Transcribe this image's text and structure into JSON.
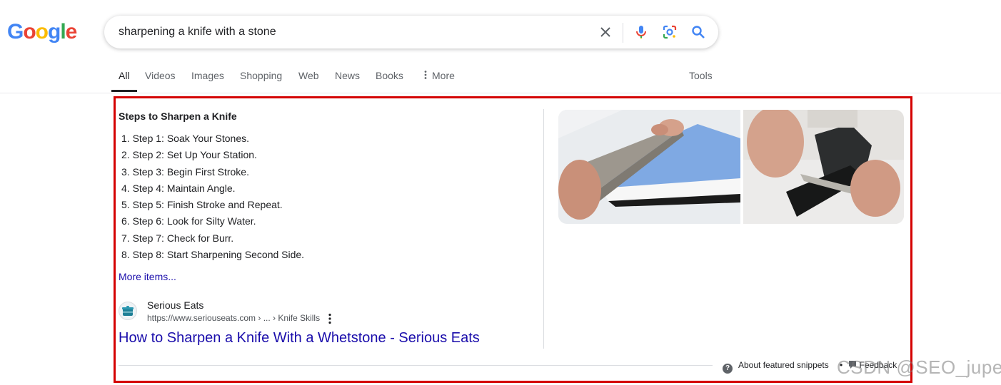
{
  "logo": {
    "letters": [
      "G",
      "o",
      "o",
      "g",
      "l",
      "e"
    ],
    "colors": [
      "#4285F4",
      "#EA4335",
      "#FBBC05",
      "#4285F4",
      "#34A853",
      "#EA4335"
    ]
  },
  "search": {
    "query": "sharpening a knife with a stone"
  },
  "tabs": [
    {
      "label": "All",
      "active": true
    },
    {
      "label": "Videos"
    },
    {
      "label": "Images"
    },
    {
      "label": "Shopping"
    },
    {
      "label": "Web"
    },
    {
      "label": "News"
    },
    {
      "label": "Books"
    },
    {
      "label": "More",
      "icon": "vertical-dots-icon"
    }
  ],
  "tools_label": "Tools",
  "snippet": {
    "title": "Steps to Sharpen a Knife",
    "steps": [
      "1. Step 1: Soak Your Stones.",
      "2. Step 2: Set Up Your Station.",
      "3. Step 3: Begin First Stroke.",
      "4. Step 4: Maintain Angle.",
      "5. Step 5: Finish Stroke and Repeat.",
      "6. Step 6: Look for Silty Water.",
      "7. Step 7: Check for Burr.",
      "8. Step 8: Start Sharpening Second Side."
    ],
    "more_items": "More items...",
    "source": {
      "name": "Serious Eats",
      "url": "https://www.seriouseats.com › ... › Knife Skills",
      "link_title": "How to Sharpen a Knife With a Whetstone - Serious Eats"
    },
    "images": [
      {
        "icon": "knife-on-blue-whetstone-image"
      },
      {
        "icon": "knife-on-black-whetstone-image"
      }
    ],
    "about_label": "About featured snippets",
    "separator": "•",
    "feedback_label": "Feedback"
  },
  "watermark": "CSDN @SEO_juper",
  "colors": {
    "link": "#1a0dab",
    "highlight_frame": "#d40000",
    "active_tab": "#202124"
  }
}
